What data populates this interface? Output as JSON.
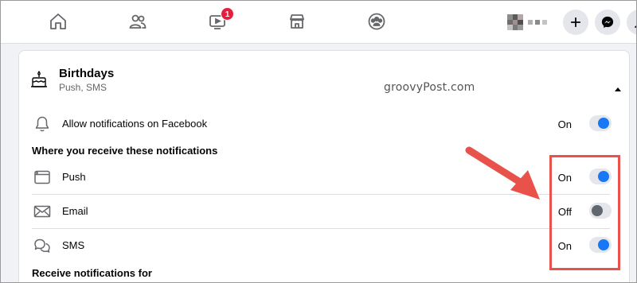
{
  "topnav": {
    "watch_badge": "1"
  },
  "section": {
    "title": "Birthdays",
    "subtitle": "Push, SMS",
    "watermark": "groovyPost.com"
  },
  "allow": {
    "label": "Allow notifications on Facebook",
    "state": "On",
    "enabled": true
  },
  "receive_heading": "Where you receive these notifications",
  "channels": [
    {
      "label": "Push",
      "state": "On",
      "enabled": true
    },
    {
      "label": "Email",
      "state": "Off",
      "enabled": false
    },
    {
      "label": "SMS",
      "state": "On",
      "enabled": true
    }
  ],
  "receive_for_heading": "Receive notifications for",
  "colors": {
    "accent": "#1877f2",
    "badge": "#e41e3f",
    "annotation": "#e8524a"
  },
  "icons": {
    "nav": [
      "home-icon",
      "friends-icon",
      "watch-icon",
      "marketplace-icon",
      "groups-icon"
    ],
    "header": [
      "plus-icon",
      "messenger-icon",
      "account-icon"
    ],
    "section": "birthday-cake-icon",
    "allow": "bell-icon",
    "channels": [
      "browser-window-icon",
      "envelope-icon",
      "chat-bubbles-icon"
    ]
  }
}
